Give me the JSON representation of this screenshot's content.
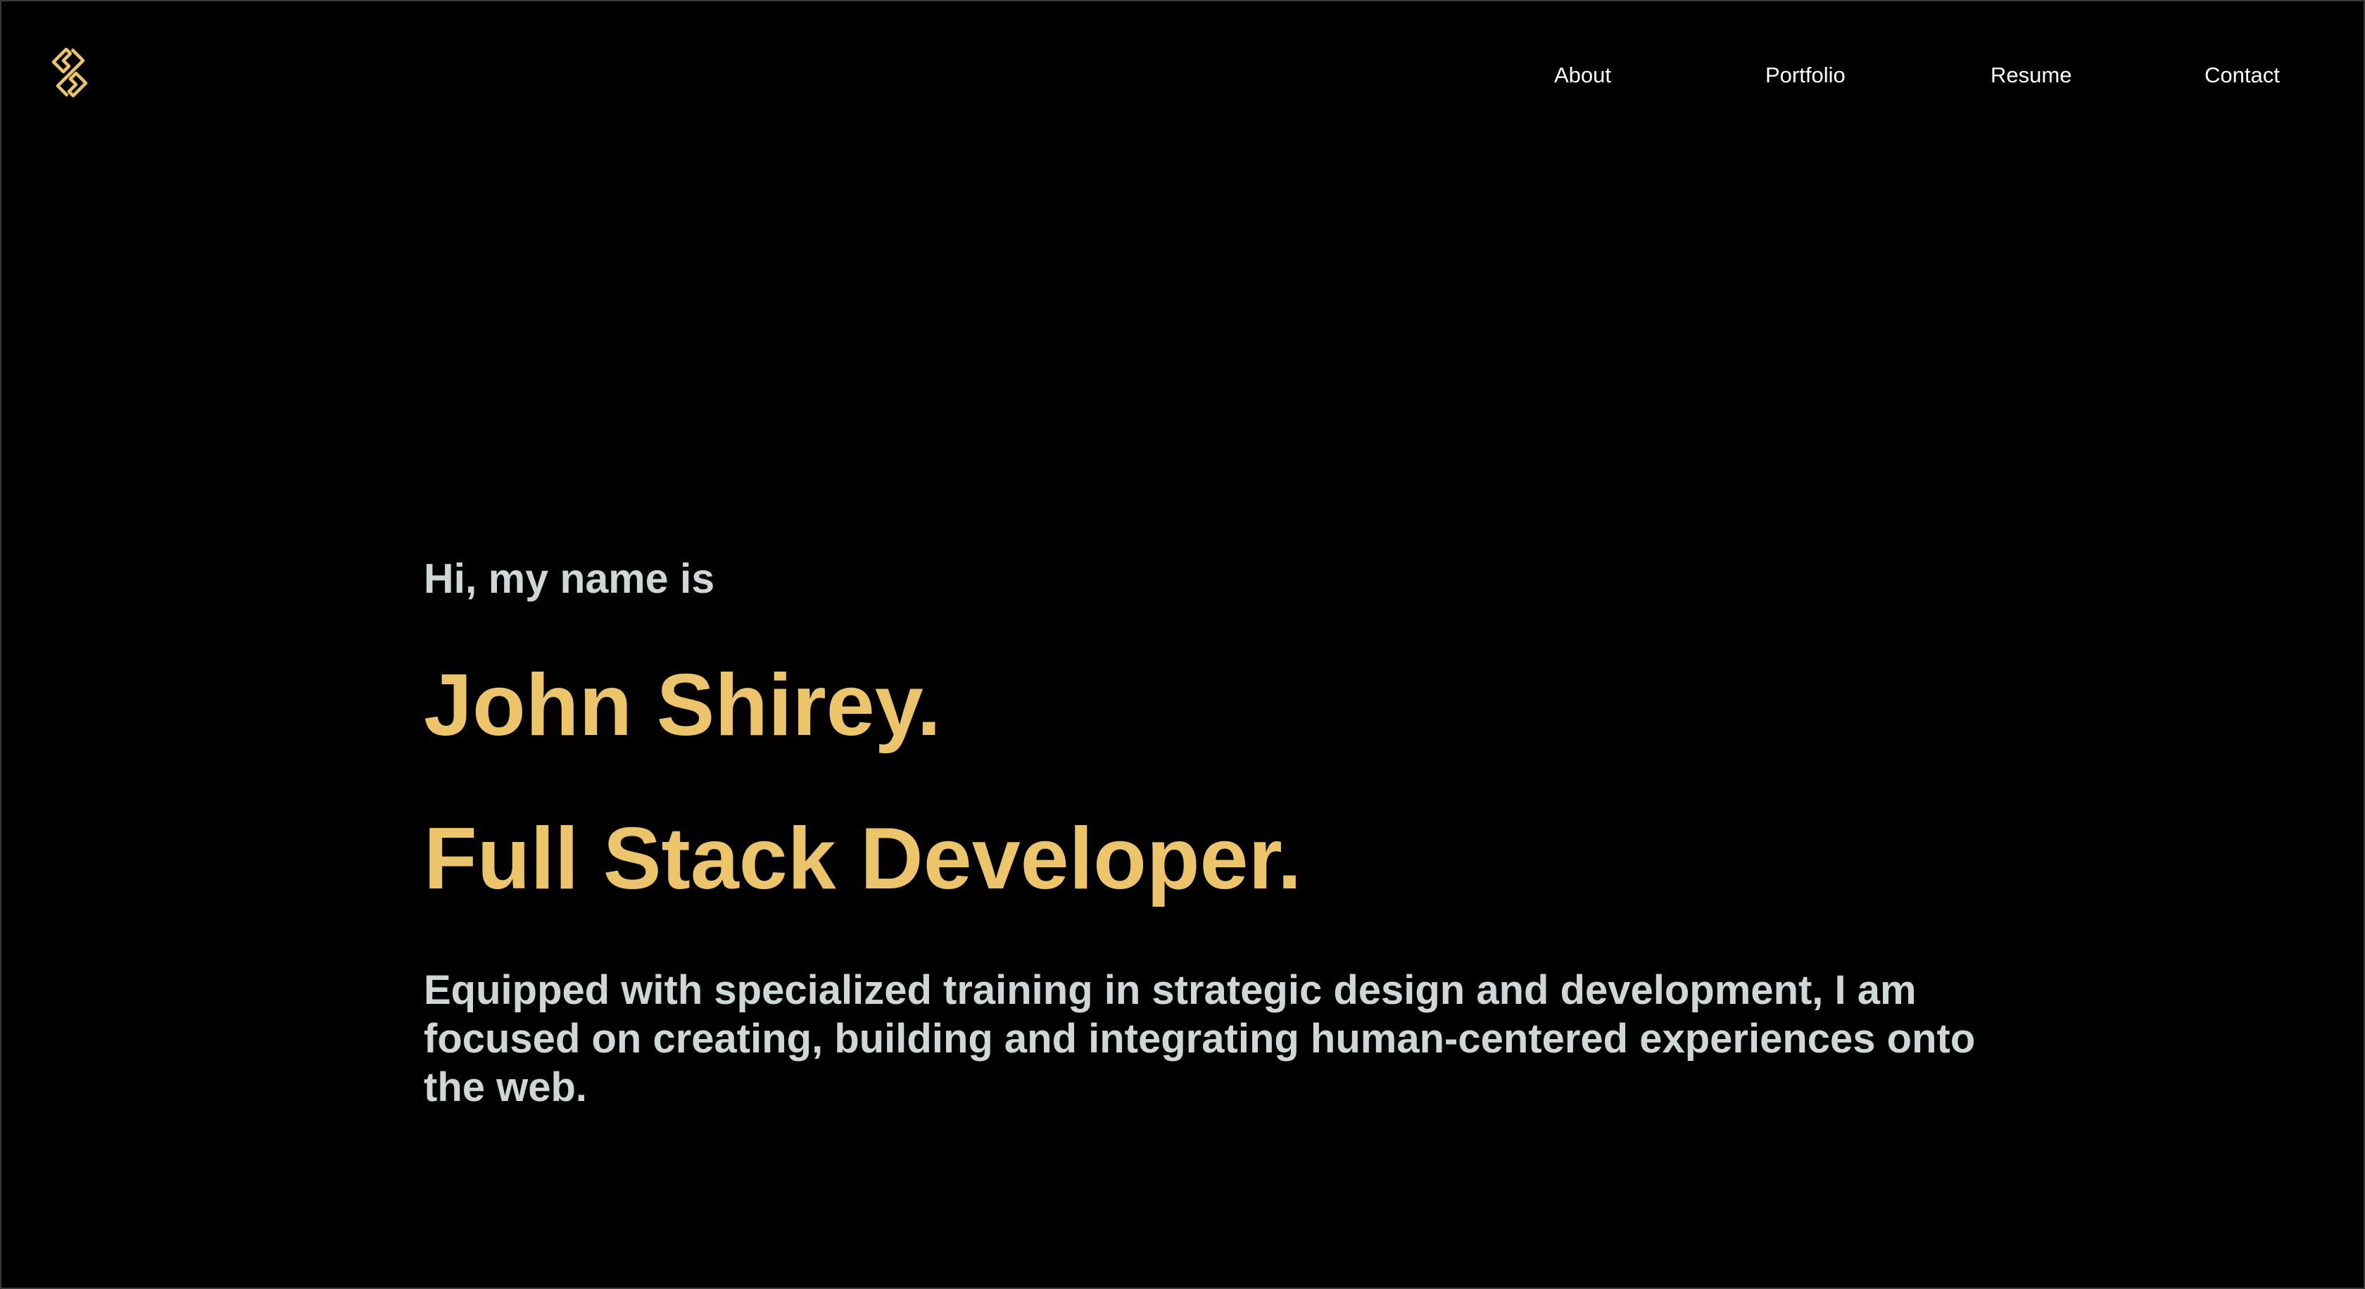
{
  "header": {
    "logo_icon": "interlocking-s-logo-icon",
    "nav": [
      {
        "label": "About"
      },
      {
        "label": "Portfolio"
      },
      {
        "label": "Resume"
      },
      {
        "label": "Contact"
      }
    ]
  },
  "hero": {
    "greeting": "Hi, my name is",
    "name": "John Shirey.",
    "role": "Full Stack Developer.",
    "description": "Equipped with specialized training in strategic design and development, I am focused on creating, building and integrating human-centered experiences onto the web."
  },
  "colors": {
    "background": "#000000",
    "accent": "#ebc46b",
    "body_text": "#cfd6d6",
    "nav_text": "#ffffff"
  }
}
